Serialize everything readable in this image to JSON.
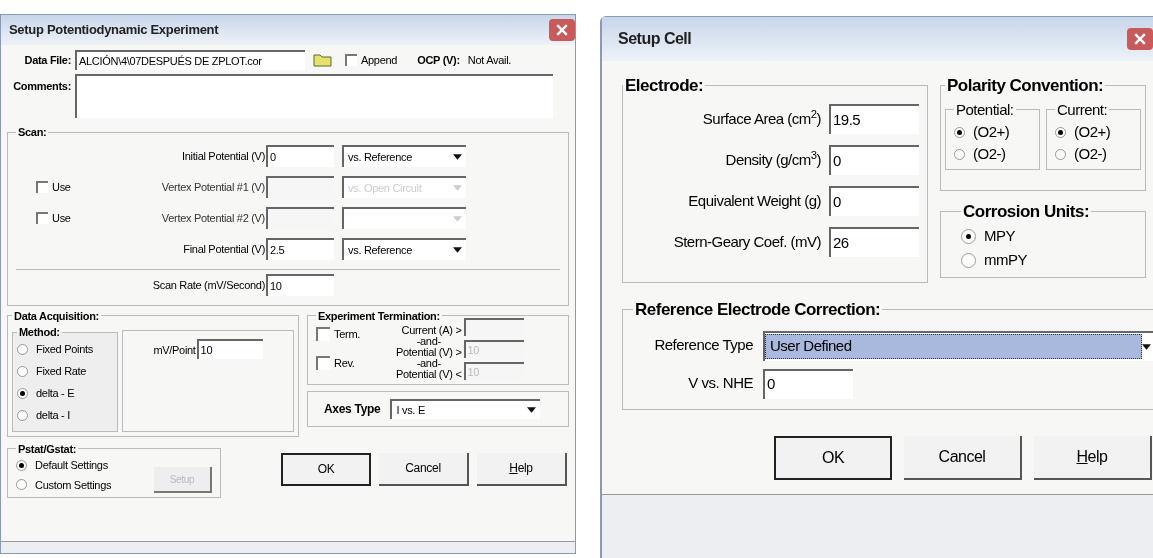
{
  "potentiodynamic_dialog": {
    "title": "Setup Potentiodynamic Experiment",
    "data_file": {
      "label": "Data File:",
      "value": "ALCIÓN\\4\\07DESPUÉS DE ZPLOT.cor"
    },
    "append": {
      "label": "Append",
      "checked": false
    },
    "ocp": {
      "label": "OCP (V):",
      "value": "Not Avail."
    },
    "comments": {
      "label": "Comments:"
    },
    "scan": {
      "title": "Scan:",
      "rows": [
        {
          "label": "Initial Potential (V)",
          "value": "0",
          "reference": "vs. Reference",
          "disabled": false
        },
        {
          "use": {
            "label": "Use",
            "checked": false
          },
          "label": "Vertex Potential #1 (V)",
          "reference": "vs. Open Circuit",
          "disabled": true
        },
        {
          "use": {
            "label": "Use",
            "checked": false
          },
          "label": "Vertex Potential #2 (V)",
          "disabled": true
        },
        {
          "label": "Final Potential (V)",
          "value": "2.5",
          "reference": "vs. Reference",
          "disabled": false
        }
      ],
      "scan_rate": {
        "label": "Scan Rate (mV/Second)",
        "value": "10"
      }
    },
    "data_acquisition": {
      "title": "Data Acquisition:",
      "method_title": "Method:",
      "methods": [
        {
          "label": "Fixed Points",
          "selected": false
        },
        {
          "label": "Fixed Rate",
          "selected": false
        },
        {
          "label": "delta - E",
          "selected": true
        },
        {
          "label": "delta - I",
          "selected": false
        }
      ],
      "mv_point": {
        "label": "mV/Point",
        "value": "10"
      }
    },
    "termination": {
      "title": "Experiment Termination:",
      "term": {
        "label": "Term.",
        "checked": false
      },
      "rev": {
        "label": "Rev.",
        "checked": false
      },
      "conditions": [
        {
          "label": "Current (A) >"
        },
        {
          "joiner": "-and-",
          "label": "Potential (V) >",
          "value": "10"
        },
        {
          "joiner": "-and-",
          "label": "Potential (V) <",
          "value": "10"
        }
      ]
    },
    "axes": {
      "label": "Axes Type",
      "value": "I vs. E"
    },
    "pstat": {
      "title": "Pstat/Gstat:",
      "options": [
        {
          "label": "Default Settings",
          "selected": true
        },
        {
          "label": "Custom Settings",
          "selected": false
        }
      ],
      "setup": {
        "label": "Setup",
        "disabled": true
      }
    },
    "buttons": [
      {
        "label": "OK",
        "default": true,
        "mnemonic": false
      },
      {
        "label": "Cancel",
        "default": false,
        "mnemonic": false
      },
      {
        "label": "Help",
        "default": false,
        "mnemonic": true
      }
    ]
  },
  "cell_dialog": {
    "title": "Setup Cell",
    "electrode": {
      "title": "Electrode:",
      "fields": [
        {
          "label": "Surface Area (cm$^{2}$)",
          "value": "19.5"
        },
        {
          "label": "Density (g/cm$^{3}$)",
          "value": "0"
        },
        {
          "label": "Equivalent Weight (g)",
          "value": "0"
        },
        {
          "label": "Stern-Geary Coef. (mV)",
          "value": "26"
        }
      ]
    },
    "polarity": {
      "title": "Polarity Convention:",
      "groups": [
        {
          "title": "Potential:",
          "options": [
            {
              "label": "(O2+)",
              "selected": true
            },
            {
              "label": "(O2-)",
              "selected": false
            }
          ]
        },
        {
          "title": "Current:",
          "options": [
            {
              "label": "(O2+)",
              "selected": true
            },
            {
              "label": "(O2-)",
              "selected": false
            }
          ]
        }
      ]
    },
    "corrosion": {
      "title": "Corrosion Units:",
      "options": [
        {
          "label": "MPY",
          "selected": true
        },
        {
          "label": "mmPY",
          "selected": false
        }
      ]
    },
    "reference": {
      "title": "Reference Electrode Correction:",
      "type": {
        "label": "Reference Type",
        "value": "User Defined",
        "focused": true
      },
      "nhe": {
        "label": "V vs. NHE",
        "value": "0"
      }
    },
    "buttons": [
      {
        "label": "OK",
        "default": true,
        "mnemonic": false
      },
      {
        "label": "Cancel",
        "default": false,
        "mnemonic": false
      },
      {
        "label": "Help",
        "default": false,
        "mnemonic": true
      }
    ]
  }
}
